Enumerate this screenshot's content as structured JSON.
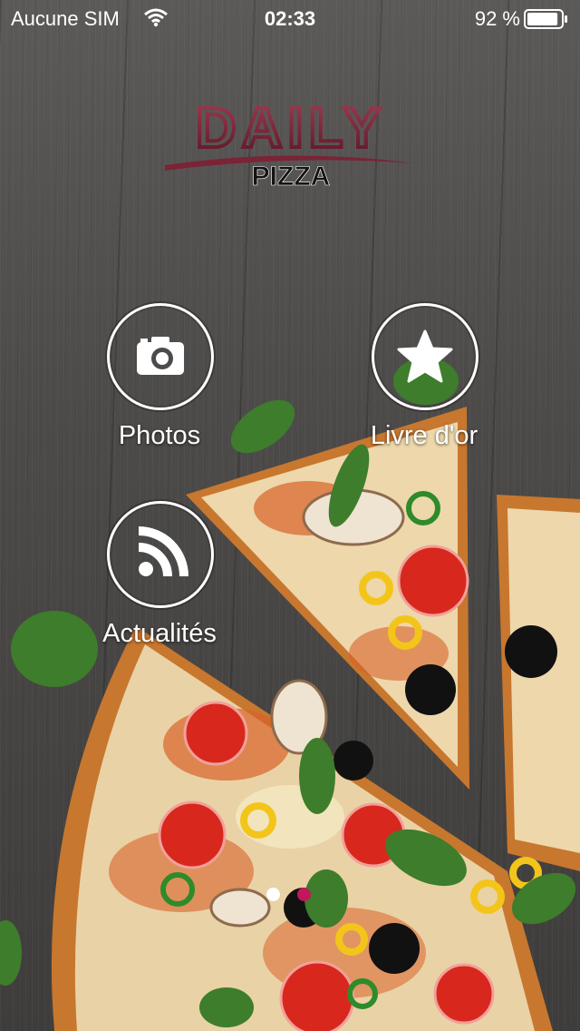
{
  "status_bar": {
    "carrier": "Aucune SIM",
    "time": "02:33",
    "battery_percent": "92 %",
    "battery_level": 0.92,
    "wifi_icon": "wifi-icon",
    "battery_icon": "battery-icon"
  },
  "logo": {
    "word_main": "DAILY",
    "word_sub": "PIZZA"
  },
  "menu": [
    {
      "label": "Photos",
      "icon": "camera-icon"
    },
    {
      "label": "Livre d'or",
      "icon": "star-icon"
    },
    {
      "label": "Actualités",
      "icon": "rss-icon"
    }
  ],
  "pager": {
    "page_count": 2,
    "current_page": 1,
    "active_color": "#ffffff",
    "inactive_color": "#c2185b"
  },
  "colors": {
    "logo_burgundy": "#7a2436",
    "text": "#ffffff"
  }
}
